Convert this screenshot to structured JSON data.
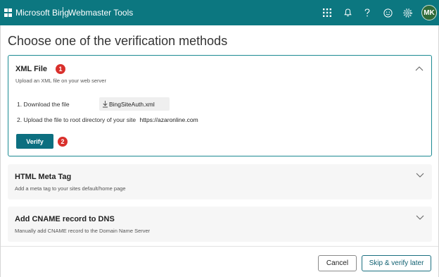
{
  "topbar": {
    "brand": "Microsoft Bing",
    "product": "Webmaster Tools",
    "user_initials": "MK",
    "icons": [
      "apps-grid-icon",
      "notification-bell-icon",
      "help-icon",
      "feedback-smiley-icon",
      "settings-gear-icon"
    ]
  },
  "dialog": {
    "title": "Choose one of the verification methods",
    "methods": [
      {
        "title": "XML File",
        "subtitle": "Upload an XML file on your web server",
        "badge": "1",
        "step1_label": "1. Download the file",
        "download_file": "BingSiteAuth.xml",
        "step2_label": "2. Upload the file to root directory of your site",
        "site_url": "https://azaronline.com",
        "verify_label": "Verify",
        "verify_badge": "2"
      },
      {
        "title": "HTML Meta Tag",
        "subtitle": "Add a meta tag to your sites default/home page"
      },
      {
        "title": "Add CNAME record to DNS",
        "subtitle": "Manually add CNAME record to the Domain Name Server"
      }
    ],
    "cancel_label": "Cancel",
    "skip_label": "Skip & verify later"
  },
  "colors": {
    "topbar": "#0c7780",
    "accent": "#0c6f80",
    "badge": "#d9302c",
    "avatar": "#2f6b3a"
  }
}
